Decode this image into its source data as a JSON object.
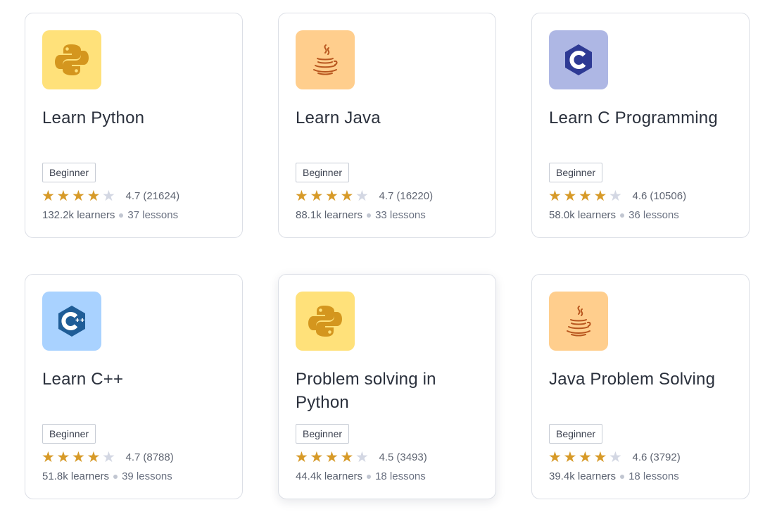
{
  "courses": [
    {
      "title": "Learn Python",
      "level": "Beginner",
      "rating": "4.7",
      "reviews": "(21624)",
      "learners": "132.2k learners",
      "lessons": "37 lessons",
      "stars": 4,
      "icon": "python-icon",
      "tile_color": "#FFE17A"
    },
    {
      "title": "Learn Java",
      "level": "Beginner",
      "rating": "4.7",
      "reviews": "(16220)",
      "learners": "88.1k learners",
      "lessons": "33 lessons",
      "stars": 4,
      "icon": "java-icon",
      "tile_color": "#FFCE8D"
    },
    {
      "title": "Learn C Programming",
      "level": "Beginner",
      "rating": "4.6",
      "reviews": "(10506)",
      "learners": "58.0k learners",
      "lessons": "36 lessons",
      "stars": 4,
      "icon": "c-language-icon",
      "tile_color": "#AEB7E4"
    },
    {
      "title": "Learn C++",
      "level": "Beginner",
      "rating": "4.7",
      "reviews": "(8788)",
      "learners": "51.8k learners",
      "lessons": "39 lessons",
      "stars": 4,
      "icon": "cpp-icon",
      "tile_color": "#A9D2FF"
    },
    {
      "title": "Problem solving in Python",
      "level": "Beginner",
      "rating": "4.5",
      "reviews": "(3493)",
      "learners": "44.4k learners",
      "lessons": "18 lessons",
      "stars": 4,
      "icon": "python-icon",
      "tile_color": "#FFE17A"
    },
    {
      "title": "Java Problem Solving",
      "level": "Beginner",
      "rating": "4.6",
      "reviews": "(3792)",
      "learners": "39.4k learners",
      "lessons": "18 lessons",
      "stars": 4,
      "icon": "java-icon",
      "tile_color": "#FFCE8D"
    }
  ],
  "colors": {
    "star_on": "#D79A28",
    "star_off": "#D3D7E3",
    "title": "#2A303C"
  }
}
